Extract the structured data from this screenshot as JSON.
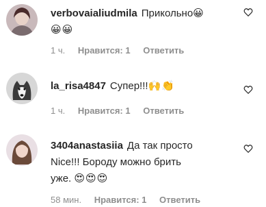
{
  "comments": [
    {
      "username": "verbovaialiudmila",
      "text": "Прикольно",
      "emoji_line": "😀",
      "emoji_line2": "😀😀",
      "time": "1 ч.",
      "likes": "Нравится: 1",
      "reply": "Ответить"
    },
    {
      "username": "la_risa4847",
      "text": "Супер!!!",
      "emoji_line": "🙌👏",
      "time": "1 ч.",
      "likes": "Нравится: 1",
      "reply": "Ответить"
    },
    {
      "username": "3404anastasiia",
      "text": "Да так просто",
      "text2": "Nice!!! Бороду можно брить",
      "text3": "уже.",
      "emoji_line": "😍😍😍",
      "time": "58 мин.",
      "likes": "Нравится: 1",
      "reply": "Ответить"
    }
  ],
  "colors": {
    "text": "#262626",
    "meta": "#8e8e8e",
    "heart_stroke": "#262626"
  },
  "icons": [
    "heart-icon",
    "avatar"
  ]
}
